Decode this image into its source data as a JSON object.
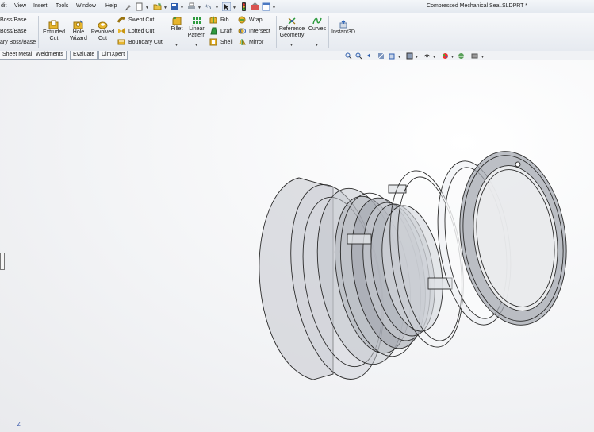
{
  "menu": [
    "dit",
    "View",
    "Insert",
    "Tools",
    "Window",
    "Help"
  ],
  "document_title": "Compressed Mechanical Seal.SLDPRT *",
  "ribbon": {
    "boss_base": [
      "Boss/Base",
      "Boss/Base",
      "ary Boss/Base"
    ],
    "extruded_cut": [
      "Extruded",
      "Cut"
    ],
    "hole_wizard": [
      "Hole",
      "Wizard"
    ],
    "revolved_cut": [
      "Revolved",
      "Cut"
    ],
    "swept_cut": "Swept Cut",
    "lofted_cut": "Lofted Cut",
    "boundary_cut": "Boundary Cut",
    "fillet": "Fillet",
    "linear_pattern": [
      "Linear",
      "Pattern"
    ],
    "rib": "Rib",
    "draft": "Draft",
    "shell": "Shell",
    "wrap": "Wrap",
    "intersect": "Intersect",
    "mirror": "Mirror",
    "reference_geometry": [
      "Reference",
      "Geometry"
    ],
    "curves": "Curves",
    "instant3d": "Instant3D"
  },
  "tabs": [
    "Sheet Metal",
    "Weldments",
    "Evaluate",
    "DimXpert"
  ],
  "axis_label": "Z",
  "colors": {
    "accent": "#1b57b5",
    "model_stroke": "#2a2a2a",
    "model_fill": "#b8bcc4"
  }
}
